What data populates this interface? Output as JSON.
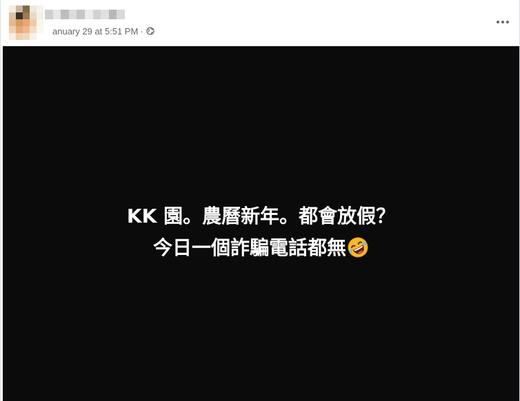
{
  "post": {
    "author_name": "",
    "timestamp": "anuary 29 at 5:51 PM",
    "separator": "·",
    "privacy_icon": "globe-icon",
    "more_icon": "more-options-icon"
  },
  "content": {
    "background": "#0b0b0b",
    "text_color": "#ffffff",
    "line1": "KK 園。農曆新年。都會放假？",
    "line2": "今日一個詐騙電話都無",
    "emoji": "rolling-on-the-floor-laughing-emoji"
  },
  "colors": {
    "meta_text": "#65676b",
    "header_bg": "#ffffff"
  }
}
